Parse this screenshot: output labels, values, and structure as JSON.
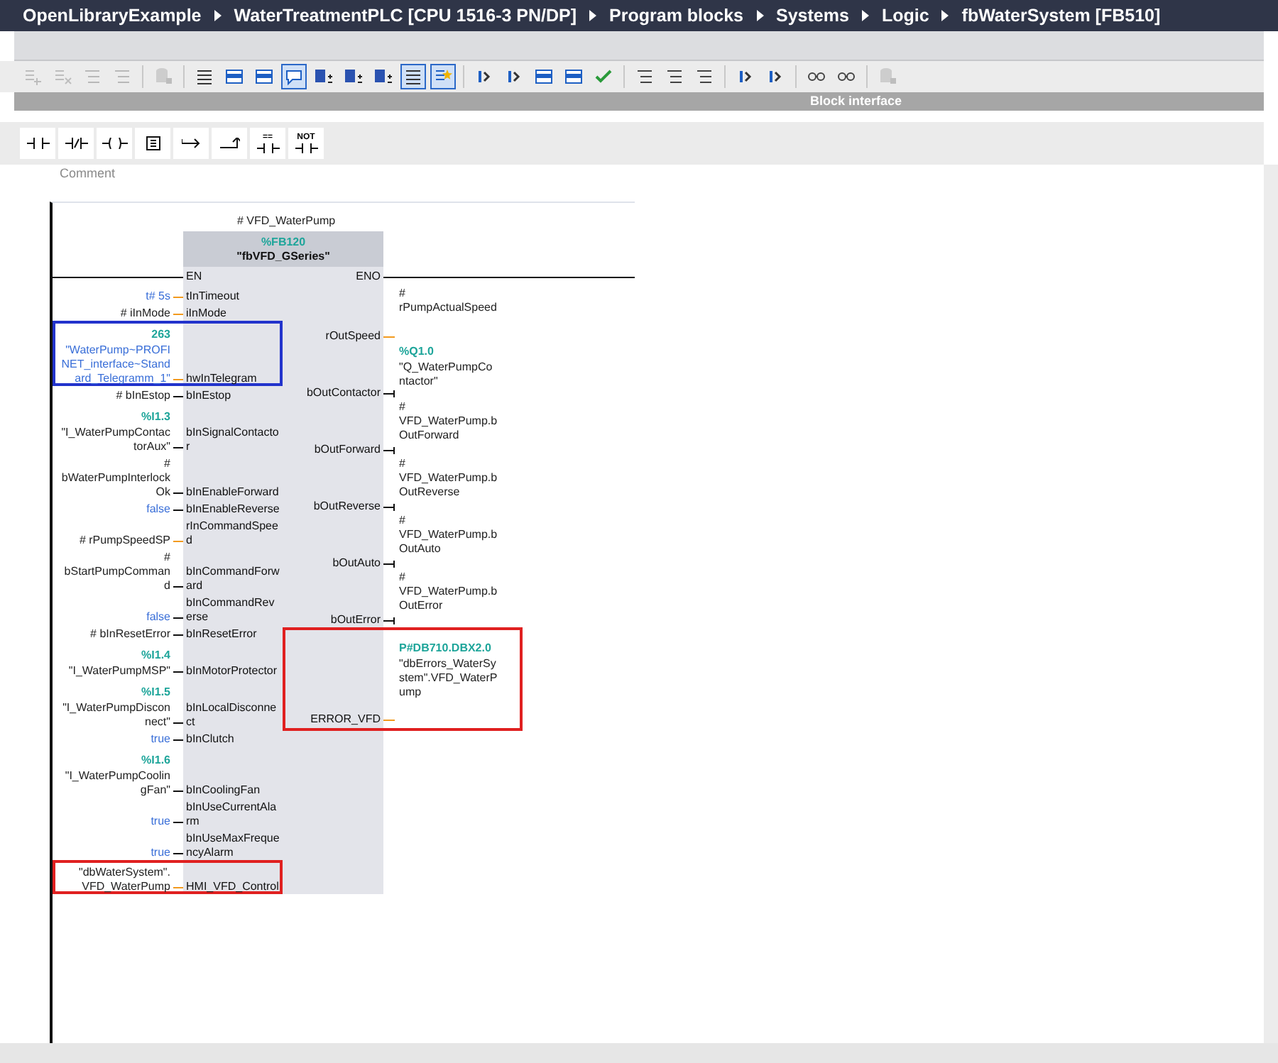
{
  "breadcrumb": [
    "OpenLibraryExample",
    "WaterTreatmentPLC [CPU 1516-3 PN/DP]",
    "Program blocks",
    "Systems",
    "Logic",
    "fbWaterSystem [FB510]"
  ],
  "toolbar": [
    [
      {
        "kind": "insert",
        "pressed": false,
        "disabled": true
      },
      {
        "kind": "delete",
        "pressed": false,
        "disabled": true
      },
      {
        "kind": "rows",
        "pressed": false,
        "disabled": true
      },
      {
        "kind": "rows",
        "pressed": false,
        "disabled": true
      }
    ],
    [
      {
        "kind": "db",
        "pressed": false,
        "disabled": true
      }
    ],
    [
      {
        "kind": "list",
        "pressed": false,
        "disabled": false
      },
      {
        "kind": "panel",
        "pressed": false,
        "disabled": false
      },
      {
        "kind": "panel",
        "pressed": false,
        "disabled": false
      },
      {
        "kind": "comment",
        "pressed": true,
        "disabled": false
      },
      {
        "kind": "dropdown",
        "pressed": false,
        "disabled": false
      },
      {
        "kind": "dropdown",
        "pressed": false,
        "disabled": false
      },
      {
        "kind": "dropdown",
        "pressed": false,
        "disabled": false
      },
      {
        "kind": "list",
        "pressed": true,
        "disabled": false
      },
      {
        "kind": "star",
        "pressed": true,
        "disabled": false
      }
    ],
    [
      {
        "kind": "arrow",
        "pressed": false,
        "disabled": false
      },
      {
        "kind": "arrow",
        "pressed": false,
        "disabled": false
      },
      {
        "kind": "panel",
        "pressed": false,
        "disabled": false
      },
      {
        "kind": "panel",
        "pressed": false,
        "disabled": false
      },
      {
        "kind": "check",
        "pressed": false,
        "disabled": false
      }
    ],
    [
      {
        "kind": "rows",
        "pressed": false,
        "disabled": false
      },
      {
        "kind": "rows",
        "pressed": false,
        "disabled": false
      },
      {
        "kind": "rows",
        "pressed": false,
        "disabled": false
      }
    ],
    [
      {
        "kind": "arrow",
        "pressed": false,
        "disabled": false
      },
      {
        "kind": "arrow",
        "pressed": false,
        "disabled": false
      }
    ],
    [
      {
        "kind": "monitor",
        "pressed": false,
        "disabled": false
      },
      {
        "kind": "monitor",
        "pressed": false,
        "disabled": false
      }
    ],
    [
      {
        "kind": "db",
        "pressed": false,
        "disabled": true
      }
    ]
  ],
  "panel_title": "Block interface",
  "instructions": [
    {
      "kind": "contact"
    },
    {
      "kind": "negated"
    },
    {
      "kind": "coil"
    },
    {
      "kind": "box"
    },
    {
      "kind": "open-branch"
    },
    {
      "kind": "close-branch"
    },
    {
      "kind": "compare",
      "label": "=="
    },
    {
      "kind": "not",
      "label": "NOT"
    }
  ],
  "network": {
    "comment": "Comment",
    "instance": "# VFD_WaterPump",
    "block": {
      "address": "%FB120",
      "name": "\"fbVFD_GSeries\"",
      "en": "EN",
      "eno": "ENO"
    },
    "inputs": [
      {
        "pin": "tInTimeout",
        "kind": "value",
        "operand": {
          "kind": "constant",
          "text": "t# 5s"
        }
      },
      {
        "pin": "iInMode",
        "kind": "value",
        "operand": {
          "kind": "tag",
          "text": "# iInMode"
        }
      },
      {
        "pin": "hwInTelegram",
        "kind": "value",
        "highlighted": true,
        "color": "#2233cc",
        "operand": {
          "kind": "constant",
          "address": "263",
          "text": "\"WaterPump~PROFINET_interface~Standard_Telegramm_1\""
        }
      },
      {
        "pin": "bInEstop",
        "kind": "bool",
        "operand": {
          "kind": "tag",
          "text": "# bInEstop"
        }
      },
      {
        "pin": "bInSignalContactor",
        "kind": "bool",
        "operand": {
          "kind": "tag",
          "address": "%I1.3",
          "text": "\"I_WaterPumpContactorAux\""
        }
      },
      {
        "pin": "bInEnableForward",
        "kind": "bool",
        "operand": {
          "kind": "tag",
          "text": "# bWaterPumpInterlockOk"
        }
      },
      {
        "pin": "bInEnableReverse",
        "kind": "bool",
        "operand": {
          "kind": "constant",
          "text": "false"
        }
      },
      {
        "pin": "rInCommandSpeed",
        "kind": "value",
        "operand": {
          "kind": "tag",
          "text": "# rPumpSpeedSP"
        }
      },
      {
        "pin": "bInCommandForward",
        "kind": "bool",
        "operand": {
          "kind": "tag",
          "text": "# bStartPumpCommand"
        }
      },
      {
        "pin": "bInCommandReverse",
        "kind": "bool",
        "operand": {
          "kind": "constant",
          "text": "false"
        }
      },
      {
        "pin": "bInResetError",
        "kind": "bool",
        "operand": {
          "kind": "tag",
          "text": "# bInResetError"
        }
      },
      {
        "pin": "bInMotorProtector",
        "kind": "bool",
        "operand": {
          "kind": "tag",
          "address": "%I1.4",
          "text": "\"I_WaterPumpMSP\""
        }
      },
      {
        "pin": "bInLocalDisconnect",
        "kind": "bool",
        "operand": {
          "kind": "tag",
          "address": "%I1.5",
          "text": "\"I_WaterPumpDisconnect\""
        }
      },
      {
        "pin": "bInClutch",
        "kind": "bool",
        "operand": {
          "kind": "constant",
          "text": "true"
        }
      },
      {
        "pin": "bInCoolingFan",
        "kind": "bool",
        "operand": {
          "kind": "tag",
          "address": "%I1.6",
          "text": "\"I_WaterPumpCoolingFan\""
        }
      },
      {
        "pin": "bInUseCurrentAlarm",
        "kind": "bool",
        "operand": {
          "kind": "constant",
          "text": "true"
        }
      },
      {
        "pin": "bInUseMaxFrequencyAlarm",
        "kind": "bool",
        "operand": {
          "kind": "constant",
          "text": "true"
        }
      },
      {
        "pin": "HMI_VFD_Control",
        "kind": "value",
        "highlighted": true,
        "color": "#e02020",
        "operand": {
          "kind": "tag",
          "text": "\"dbWaterSystem\". VFD_WaterPump"
        }
      }
    ],
    "outputs": [
      {
        "pin": "rOutSpeed",
        "kind": "value",
        "operand": {
          "kind": "tag",
          "text": "# rPumpActualSpeed"
        }
      },
      {
        "pin": "bOutContactor",
        "kind": "bool",
        "operand": {
          "kind": "tag",
          "address": "%Q1.0",
          "text": "\"Q_WaterPumpContactor\""
        }
      },
      {
        "pin": "bOutForward",
        "kind": "bool",
        "operand": {
          "kind": "tag",
          "text": "# VFD_WaterPump.bOutForward"
        }
      },
      {
        "pin": "bOutReverse",
        "kind": "bool",
        "operand": {
          "kind": "tag",
          "text": "# VFD_WaterPump.bOutReverse"
        }
      },
      {
        "pin": "bOutAuto",
        "kind": "bool",
        "operand": {
          "kind": "tag",
          "text": "# VFD_WaterPump.bOutAuto"
        }
      },
      {
        "pin": "bOutError",
        "kind": "bool",
        "operand": {
          "kind": "tag",
          "text": "# VFD_WaterPump.bOutError"
        }
      },
      {
        "pin": "ERROR_VFD",
        "kind": "value",
        "highlighted": true,
        "color": "#e02020",
        "operand": {
          "kind": "tag",
          "address": "P#DB710.DBX2.0",
          "text": "\"dbErrors_WaterSystem\".VFD_WaterPump"
        }
      }
    ]
  }
}
